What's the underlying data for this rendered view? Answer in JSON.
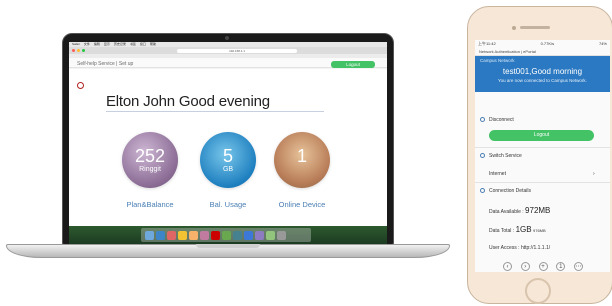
{
  "laptop": {
    "browser": {
      "menu_items": [
        "Safari",
        "文件",
        "编辑",
        "显示",
        "历史记录",
        "书签",
        "窗口",
        "帮助"
      ],
      "url": "192.168.1.1"
    },
    "portal": {
      "nav": "Self-help Service | Set up",
      "logout": "Logout",
      "greeting": "Elton John Good evening",
      "stats": [
        {
          "value": "252",
          "unit": "Ringgit",
          "label": "Plan&Balance"
        },
        {
          "value": "5",
          "unit": "GB",
          "label": "Bal. Usage"
        },
        {
          "value": "1",
          "unit": "",
          "label": "Online Device"
        }
      ]
    }
  },
  "phone": {
    "status": {
      "time": "上午11:42",
      "net": "0.77K/s",
      "battery": "74%"
    },
    "title": "Network Authentication | ePortal",
    "banner": {
      "subtitle": "Campus Network",
      "user": "test001,Good morning",
      "message": "You are now connected to Campus Network."
    },
    "disconnect": "Disconnect",
    "logout": "Logout",
    "switch_service": "Switch Service",
    "service": "Internet",
    "connection_details": "Connection Details",
    "data_available_label": "Data Available :",
    "data_available_value": "972MB",
    "data_total_label": "Data Total :",
    "data_total_value": "1GB",
    "data_total_extra": "976MB",
    "user_access": "User Access : http://1.1.1.1/"
  },
  "colors": {
    "green": "#44c266",
    "blue": "#2b79c2"
  }
}
